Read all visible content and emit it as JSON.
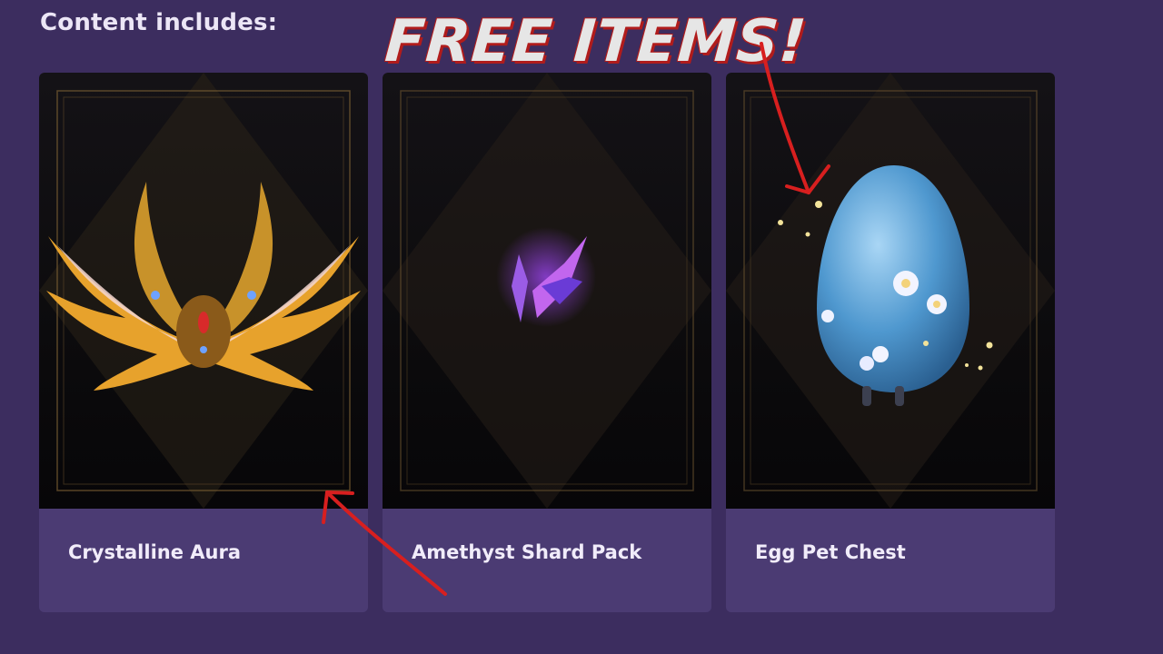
{
  "section": {
    "title": "Content includes:"
  },
  "overlay": {
    "title": "FREE ITEMS!",
    "color": "#e6e6e6",
    "outline": "#b01c1c"
  },
  "colors": {
    "background": "#3c2d5f",
    "card_footer": "#4b3b73",
    "arrow": "#d81f1f"
  },
  "items": [
    {
      "name": "Crystalline Aura",
      "icon": "golden-wings-icon"
    },
    {
      "name": "Amethyst Shard Pack",
      "icon": "amethyst-shard-icon"
    },
    {
      "name": "Egg Pet Chest",
      "icon": "blue-egg-icon"
    }
  ]
}
